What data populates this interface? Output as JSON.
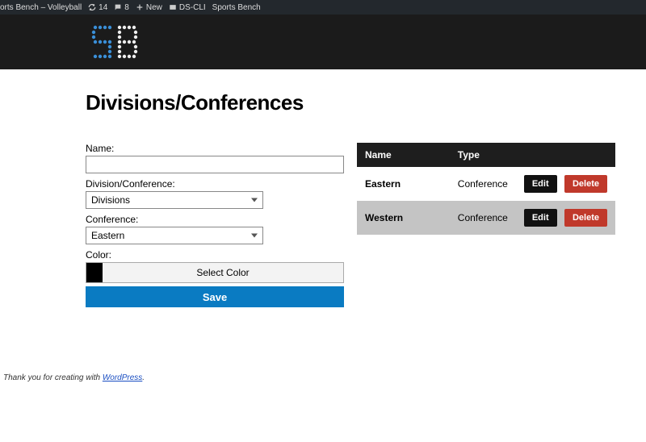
{
  "adminbar": {
    "site_name": "orts Bench – Volleyball",
    "refresh_count": "14",
    "comments_count": "8",
    "new_label": "New",
    "dscli_label": "DS-CLI",
    "sportsbench_label": "Sports Bench"
  },
  "page": {
    "title": "Divisions/Conferences"
  },
  "form": {
    "name_label": "Name:",
    "name_value": "",
    "divconf_label": "Division/Conference:",
    "divconf_value": "Divisions",
    "conference_label": "Conference:",
    "conference_value": "Eastern",
    "color_label": "Color:",
    "color_button": "Select Color",
    "color_value": "#000000",
    "save_label": "Save"
  },
  "table": {
    "headers": {
      "name": "Name",
      "type": "Type"
    },
    "edit_label": "Edit",
    "delete_label": "Delete",
    "rows": [
      {
        "name": "Eastern",
        "type": "Conference"
      },
      {
        "name": "Western",
        "type": "Conference"
      }
    ]
  },
  "footer": {
    "text": "Thank you for creating with ",
    "link_text": "WordPress",
    "period": "."
  }
}
